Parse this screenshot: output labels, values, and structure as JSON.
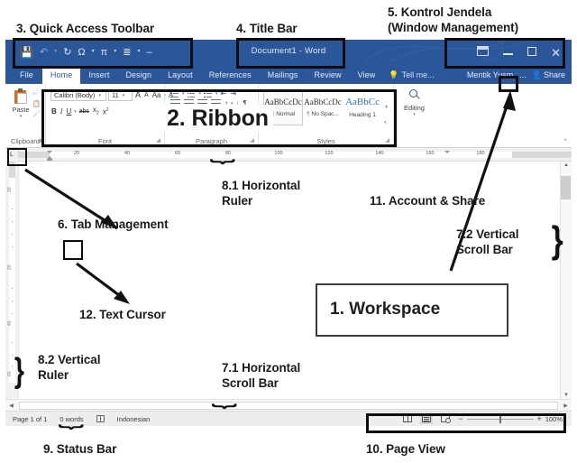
{
  "window": {
    "title": "Document1 - Word",
    "quick_access": [
      {
        "name": "save-icon",
        "glyph": "💾"
      },
      {
        "name": "undo-icon",
        "glyph": "↶"
      },
      {
        "name": "redo-icon",
        "glyph": "↻"
      },
      {
        "name": "symbol-omega-icon",
        "glyph": "Ω"
      },
      {
        "name": "equation-pi-icon",
        "glyph": "π"
      },
      {
        "name": "numbering-icon",
        "glyph": "≣"
      },
      {
        "name": "customize-qat-icon",
        "glyph": "–"
      }
    ],
    "controls": {
      "ribbon_display": "Ribbon Display Options",
      "minimize": "Minimize",
      "maximize": "Maximize",
      "close": "✕"
    }
  },
  "tabs": [
    {
      "label": "File",
      "active": false
    },
    {
      "label": "Home",
      "active": true
    },
    {
      "label": "Insert",
      "active": false
    },
    {
      "label": "Design",
      "active": false
    },
    {
      "label": "Layout",
      "active": false
    },
    {
      "label": "References",
      "active": false
    },
    {
      "label": "Mailings",
      "active": false
    },
    {
      "label": "Review",
      "active": false
    },
    {
      "label": "View",
      "active": false
    }
  ],
  "tellme": "Tell me...",
  "account": "Mentik Yusm",
  "account_more": "...",
  "share": "Share",
  "ribbon": {
    "clipboard": {
      "group_label": "Clipboard",
      "paste_label": "Paste",
      "paste_caret": "▾"
    },
    "font": {
      "group_label": "Font",
      "font_name": "Calibri (Body)",
      "font_size": "11",
      "grow_font": "A",
      "shrink_font": "A",
      "change_case": "Aa",
      "clear_format": "A",
      "bold": "B",
      "italic": "I",
      "underline": "U",
      "strikethrough": "abc",
      "subscript": "x",
      "superscript": "x",
      "text_effects": "A"
    },
    "paragraph": {
      "group_label": "Paragraph",
      "pilcrow": "¶",
      "sort": "↓"
    },
    "styles": {
      "group_label": "Styles",
      "items": [
        {
          "sample": "AaBbCcDc",
          "name": "Normal",
          "pilcrow": "¶",
          "selected": true,
          "blue": false
        },
        {
          "sample": "AaBbCcDc",
          "name": "No Spac...",
          "pilcrow": "¶",
          "selected": false,
          "blue": false
        },
        {
          "sample": "AaBbCc",
          "name": "Heading 1",
          "pilcrow": "",
          "selected": false,
          "blue": true
        }
      ]
    },
    "editing": {
      "group_label": "",
      "label": "Editing",
      "caret": "▾"
    },
    "collapse": "⌃"
  },
  "ruler": {
    "tab_selector": "L",
    "h_ticks": [
      "20",
      "40",
      "60",
      "80",
      "100",
      "120",
      "140",
      "160",
      "180"
    ],
    "v_ticks": [
      "20",
      "20",
      "40",
      "60"
    ]
  },
  "status_bar": {
    "page": "Page 1 of 1",
    "words": "0 words",
    "proofing_icon": "proofing-errors-icon",
    "language": "Indonesian",
    "views": [
      {
        "name": "read-mode-view",
        "active": false
      },
      {
        "name": "print-layout-view",
        "active": true
      },
      {
        "name": "web-layout-view",
        "active": false
      }
    ],
    "zoom_out": "−",
    "zoom_in": "+",
    "zoom_value": "100%"
  },
  "annotations": [
    {
      "id": "3",
      "text": "3. Quick Access Toolbar"
    },
    {
      "id": "4",
      "text": "4. Title Bar"
    },
    {
      "id": "5a",
      "text": "5. Kontrol Jendela"
    },
    {
      "id": "5b",
      "text": "(Window Management)"
    },
    {
      "id": "2",
      "text": "2. Ribbon"
    },
    {
      "id": "8.1a",
      "text": "8.1 Horizontal"
    },
    {
      "id": "8.1b",
      "text": "Ruler"
    },
    {
      "id": "11",
      "text": "11. Account & Share"
    },
    {
      "id": "6",
      "text": "6. Tab Management"
    },
    {
      "id": "7.2a",
      "text": "7.2 Vertical"
    },
    {
      "id": "7.2b",
      "text": "Scroll Bar"
    },
    {
      "id": "1",
      "text": "1. Workspace"
    },
    {
      "id": "12",
      "text": "12. Text Cursor"
    },
    {
      "id": "8.2a",
      "text": "8.2 Vertical"
    },
    {
      "id": "8.2b",
      "text": "Ruler"
    },
    {
      "id": "7.1a",
      "text": "7.1 Horizontal"
    },
    {
      "id": "7.1b",
      "text": "Scroll Bar"
    },
    {
      "id": "9",
      "text": "9. Status Bar"
    },
    {
      "id": "10",
      "text": "10. Page View"
    }
  ]
}
